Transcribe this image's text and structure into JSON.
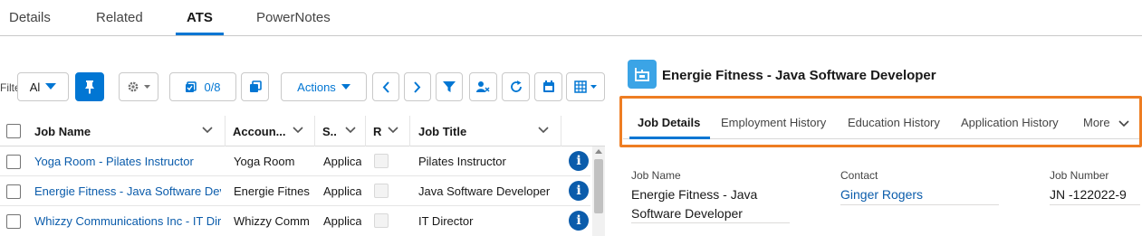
{
  "top_tabs": [
    {
      "label": "Details"
    },
    {
      "label": "Related"
    },
    {
      "label": "ATS"
    },
    {
      "label": "PowerNotes"
    }
  ],
  "toolbar": {
    "filter_label": "Filte",
    "filter_value": "Al",
    "selection_count": "0/8",
    "actions_label": "Actions"
  },
  "table": {
    "columns": [
      {
        "label": "Job Name"
      },
      {
        "label": "Accoun..."
      },
      {
        "label": "S.."
      },
      {
        "label": "R"
      },
      {
        "label": "Job Title"
      }
    ],
    "rows": [
      {
        "job_name": "Yoga Room - Pilates Instructor",
        "account": "Yoga Room",
        "status": "Applica",
        "job_title": "Pilates Instructor"
      },
      {
        "job_name": "Energie Fitness - Java Software Deve",
        "account": "Energie Fitness",
        "status": "Applica",
        "job_title": "Java Software Developer"
      },
      {
        "job_name": "Whizzy Communications Inc - IT Dir",
        "account": "Whizzy Comm",
        "status": "Applica",
        "job_title": "IT Director"
      }
    ]
  },
  "record": {
    "title": "Energie Fitness - Java Software Developer",
    "tabs": [
      {
        "label": "Job Details"
      },
      {
        "label": "Employment History"
      },
      {
        "label": "Education History"
      },
      {
        "label": "Application History"
      },
      {
        "label": "More"
      }
    ],
    "fields": {
      "job_name_label": "Job Name",
      "job_name_line1": "Energie Fitness - Java",
      "job_name_line2": "Software Developer",
      "contact_label": "Contact",
      "contact_value": "Ginger Rogers",
      "job_number_label": "Job Number",
      "job_number_value": "JN -122022-9"
    }
  },
  "colors": {
    "brand": "#0176d3",
    "link": "#0b5cab",
    "highlight": "#ee7d22",
    "record_icon": "#3ba4e6"
  }
}
